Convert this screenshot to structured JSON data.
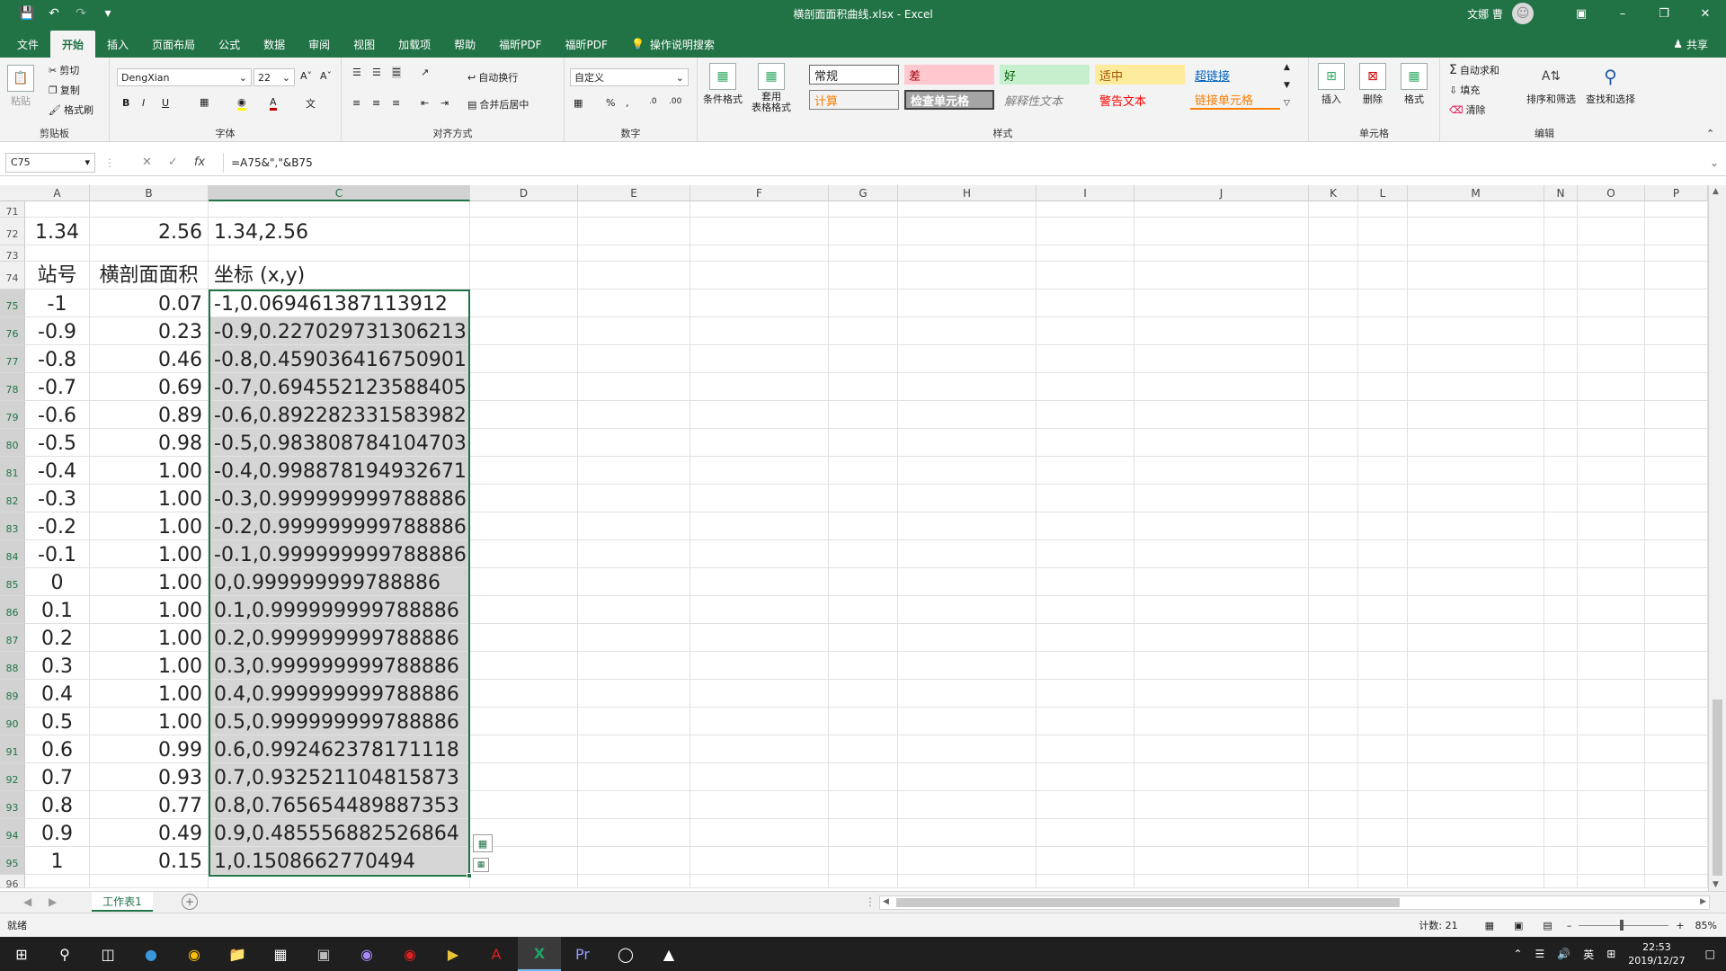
{
  "window": {
    "title": "横剖面面积曲线.xlsx  -  Excel",
    "user": "文娜 曹"
  },
  "tabs": [
    "文件",
    "开始",
    "插入",
    "页面布局",
    "公式",
    "数据",
    "审阅",
    "视图",
    "加载项",
    "帮助",
    "福昕PDF",
    "福昕PDF",
    "操作说明搜索"
  ],
  "share": "共享",
  "ribbon": {
    "clipboard": {
      "paste": "粘贴",
      "cut": "剪切",
      "copy": "复制",
      "format_painter": "格式刷",
      "label": "剪贴板"
    },
    "font": {
      "name": "DengXian",
      "size": "22",
      "label": "字体"
    },
    "alignment": {
      "wrap": "自动换行",
      "merge": "合并后居中",
      "label": "对齐方式"
    },
    "number": {
      "format": "自定义",
      "label": "数字"
    },
    "styles": {
      "conditional": "条件格式",
      "table": "套用\n表格格式",
      "cells": [
        "常规",
        "差",
        "好",
        "适中",
        "超链接",
        "计算",
        "检查单元格",
        "解释性文本",
        "警告文本",
        "链接单元格"
      ],
      "label": "样式"
    },
    "cells": {
      "insert": "插入",
      "delete": "删除",
      "format": "格式",
      "label": "单元格"
    },
    "editing": {
      "autosum": "自动求和",
      "fill": "填充",
      "clear": "清除",
      "sort": "排序和筛选",
      "find": "查找和选择",
      "label": "编辑"
    }
  },
  "formula_bar": {
    "name_box": "C75",
    "formula": "=A75&\",\"&B75"
  },
  "columns": [
    "A",
    "B",
    "C",
    "D",
    "E",
    "F",
    "G",
    "H",
    "I",
    "J",
    "K",
    "L",
    "M",
    "N",
    "O",
    "P"
  ],
  "rows": [
    {
      "num": "71",
      "a": "",
      "b": "",
      "c": ""
    },
    {
      "num": "72",
      "a": "1.34",
      "b": "2.56",
      "c": "1.34,2.56"
    },
    {
      "num": "73",
      "a": "",
      "b": "",
      "c": ""
    },
    {
      "num": "74",
      "a": "站号",
      "b": "横剖面面积",
      "c": "坐标   (x,y)"
    },
    {
      "num": "75",
      "a": "-1",
      "b": "0.07",
      "c": "-1,0.069461387113912"
    },
    {
      "num": "76",
      "a": "-0.9",
      "b": "0.23",
      "c": "-0.9,0.227029731306213"
    },
    {
      "num": "77",
      "a": "-0.8",
      "b": "0.46",
      "c": "-0.8,0.459036416750901"
    },
    {
      "num": "78",
      "a": "-0.7",
      "b": "0.69",
      "c": "-0.7,0.694552123588405"
    },
    {
      "num": "79",
      "a": "-0.6",
      "b": "0.89",
      "c": "-0.6,0.892282331583982"
    },
    {
      "num": "80",
      "a": "-0.5",
      "b": "0.98",
      "c": "-0.5,0.983808784104703"
    },
    {
      "num": "81",
      "a": "-0.4",
      "b": "1.00",
      "c": "-0.4,0.998878194932671"
    },
    {
      "num": "82",
      "a": "-0.3",
      "b": "1.00",
      "c": "-0.3,0.999999999788886"
    },
    {
      "num": "83",
      "a": "-0.2",
      "b": "1.00",
      "c": "-0.2,0.999999999788886"
    },
    {
      "num": "84",
      "a": "-0.1",
      "b": "1.00",
      "c": "-0.1,0.999999999788886"
    },
    {
      "num": "85",
      "a": "0",
      "b": "1.00",
      "c": "0,0.999999999788886"
    },
    {
      "num": "86",
      "a": "0.1",
      "b": "1.00",
      "c": "0.1,0.999999999788886"
    },
    {
      "num": "87",
      "a": "0.2",
      "b": "1.00",
      "c": "0.2,0.999999999788886"
    },
    {
      "num": "88",
      "a": "0.3",
      "b": "1.00",
      "c": "0.3,0.999999999788886"
    },
    {
      "num": "89",
      "a": "0.4",
      "b": "1.00",
      "c": "0.4,0.999999999788886"
    },
    {
      "num": "90",
      "a": "0.5",
      "b": "1.00",
      "c": "0.5,0.999999999788886"
    },
    {
      "num": "91",
      "a": "0.6",
      "b": "0.99",
      "c": "0.6,0.992462378171118"
    },
    {
      "num": "92",
      "a": "0.7",
      "b": "0.93",
      "c": "0.7,0.932521104815873"
    },
    {
      "num": "93",
      "a": "0.8",
      "b": "0.77",
      "c": "0.8,0.765654489887353"
    },
    {
      "num": "94",
      "a": "0.9",
      "b": "0.49",
      "c": "0.9,0.485556882526864"
    },
    {
      "num": "95",
      "a": "1",
      "b": "0.15",
      "c": "1,0.1508662770494"
    },
    {
      "num": "96",
      "a": "",
      "b": "",
      "c": ""
    }
  ],
  "sheet": {
    "name": "工作表1"
  },
  "status": {
    "ready": "就绪",
    "count": "计数: 21",
    "zoom": "85%"
  },
  "taskbar": {
    "ime": "英",
    "time": "22:53",
    "date": "2019/12/27"
  },
  "colors": {
    "excel_green": "#217346",
    "selection_fill": "#d5d5d5"
  }
}
